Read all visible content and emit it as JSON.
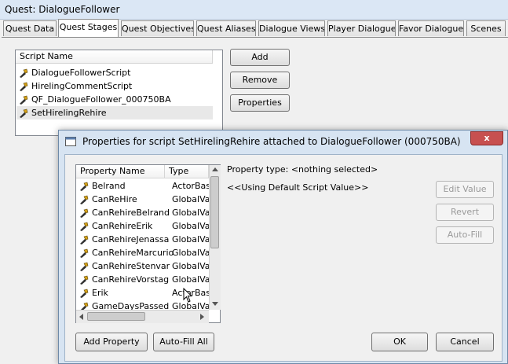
{
  "window": {
    "title": "Quest: DialogueFollower"
  },
  "tabs": [
    "Quest Data",
    "Quest Stages",
    "Quest Objectives",
    "Quest Aliases",
    "Dialogue Views",
    "Player Dialogue",
    "Favor Dialogue",
    "Scenes"
  ],
  "scripts": {
    "header": "Script Name",
    "items": [
      "DialogueFollowerScript",
      "HirelingCommentScript",
      "QF_DialogueFollower_000750BA",
      "SetHirelingRehire"
    ],
    "buttons": {
      "add": "Add",
      "remove": "Remove",
      "properties": "Properties"
    }
  },
  "dialog": {
    "title": "Properties for script SetHirelingRehire attached to DialogueFollower (000750BA)",
    "close": "x",
    "headers": {
      "name": "Property Name",
      "type": "Type"
    },
    "properties": [
      {
        "name": "Belrand",
        "type": "ActorBase"
      },
      {
        "name": "CanReHire",
        "type": "GlobalVari"
      },
      {
        "name": "CanRehireBelrand",
        "type": "GlobalVari"
      },
      {
        "name": "CanRehireErik",
        "type": "GlobalVari"
      },
      {
        "name": "CanRehireJenassa",
        "type": "GlobalVari"
      },
      {
        "name": "CanRehireMarcurio",
        "type": "GlobalVari"
      },
      {
        "name": "CanRehireStenvar",
        "type": "GlobalVari"
      },
      {
        "name": "CanRehireVorstag",
        "type": "GlobalVari"
      },
      {
        "name": "Erik",
        "type": "ActorBase"
      },
      {
        "name": "GameDaysPassed",
        "type": "GlobalVari"
      }
    ],
    "property_type": "Property type: <nothing selected>",
    "default_value": "<<Using Default Script Value>>",
    "buttons": {
      "edit_value": "Edit Value",
      "revert": "Revert",
      "auto_fill": "Auto-Fill",
      "add_property": "Add Property",
      "auto_fill_all": "Auto-Fill All",
      "ok": "OK",
      "cancel": "Cancel"
    }
  }
}
